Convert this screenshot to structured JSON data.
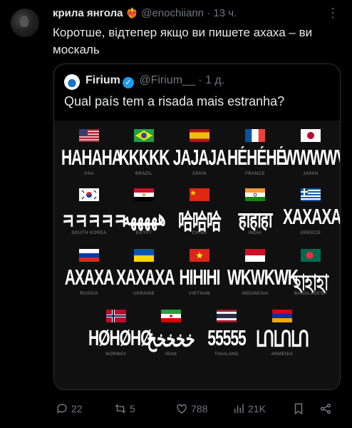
{
  "author": {
    "name": "крила янгола",
    "handle": "@enochiiann",
    "time": "13 ч.",
    "heart_icon": "heart-fire-emoji"
  },
  "tweet_text": "Коротше, відтепер якщо ви пишете ахаха – ви москаль",
  "quote": {
    "name": "Firium",
    "handle": "@Firium__",
    "time": "1 д.",
    "text": "Qual país tem a risada mais estranha?"
  },
  "infographic": {
    "rows": [
      [
        {
          "laugh": "HAHAHA",
          "country": "USA",
          "flag": "us"
        },
        {
          "laugh": "KKKKK",
          "country": "BRAZIL",
          "flag": "br"
        },
        {
          "laugh": "JAJAJA",
          "country": "SPAIN",
          "flag": "es"
        },
        {
          "laugh": "HÉHÉHÉ",
          "country": "FRANCE",
          "flag": "fr"
        },
        {
          "laugh": "WWWWV",
          "country": "JAPAN",
          "flag": "jp"
        }
      ],
      [
        {
          "laugh": "ㅋㅋㅋㅋㅋ",
          "country": "SOUTH KOREA",
          "flag": "kr"
        },
        {
          "laugh": "هههههه",
          "country": "EGYPT",
          "flag": "eg"
        },
        {
          "laugh": "哈哈哈",
          "country": "CHINA",
          "flag": "cn"
        },
        {
          "laugh": "हाहाहा",
          "country": "INDIA",
          "flag": "in"
        },
        {
          "laugh": "ΧΑΧΑΧΑ",
          "country": "GREECE",
          "flag": "gr"
        }
      ],
      [
        {
          "laugh": "АХАХА",
          "country": "RUSSIA",
          "flag": "ru"
        },
        {
          "laugh": "ХАХАХА",
          "country": "UKRAINE",
          "flag": "ua"
        },
        {
          "laugh": "HIHIHI",
          "country": "VIETNAM",
          "flag": "vn"
        },
        {
          "laugh": "WKWKWK",
          "country": "INDONESIA",
          "flag": "id"
        },
        {
          "laugh": "হাহাহা",
          "country": "BANGLADESH",
          "flag": "bd"
        }
      ],
      [
        {
          "laugh": "HØHØHØ",
          "country": "NORWAY",
          "flag": "no"
        },
        {
          "laugh": "خخخخخ",
          "country": "IRAN",
          "flag": "ir"
        },
        {
          "laugh": "55555",
          "country": "THAILAND",
          "flag": "th"
        },
        {
          "laugh": "ԼՈԼՈԼՈ",
          "country": "ARMENIA",
          "flag": "am"
        }
      ]
    ]
  },
  "actions": {
    "replies": "22",
    "reposts": "5",
    "likes": "788",
    "views": "21K"
  },
  "colors": {
    "background": "#000000",
    "text": "#e7e9ea",
    "muted": "#71767b",
    "verified": "#1d9bf0"
  }
}
